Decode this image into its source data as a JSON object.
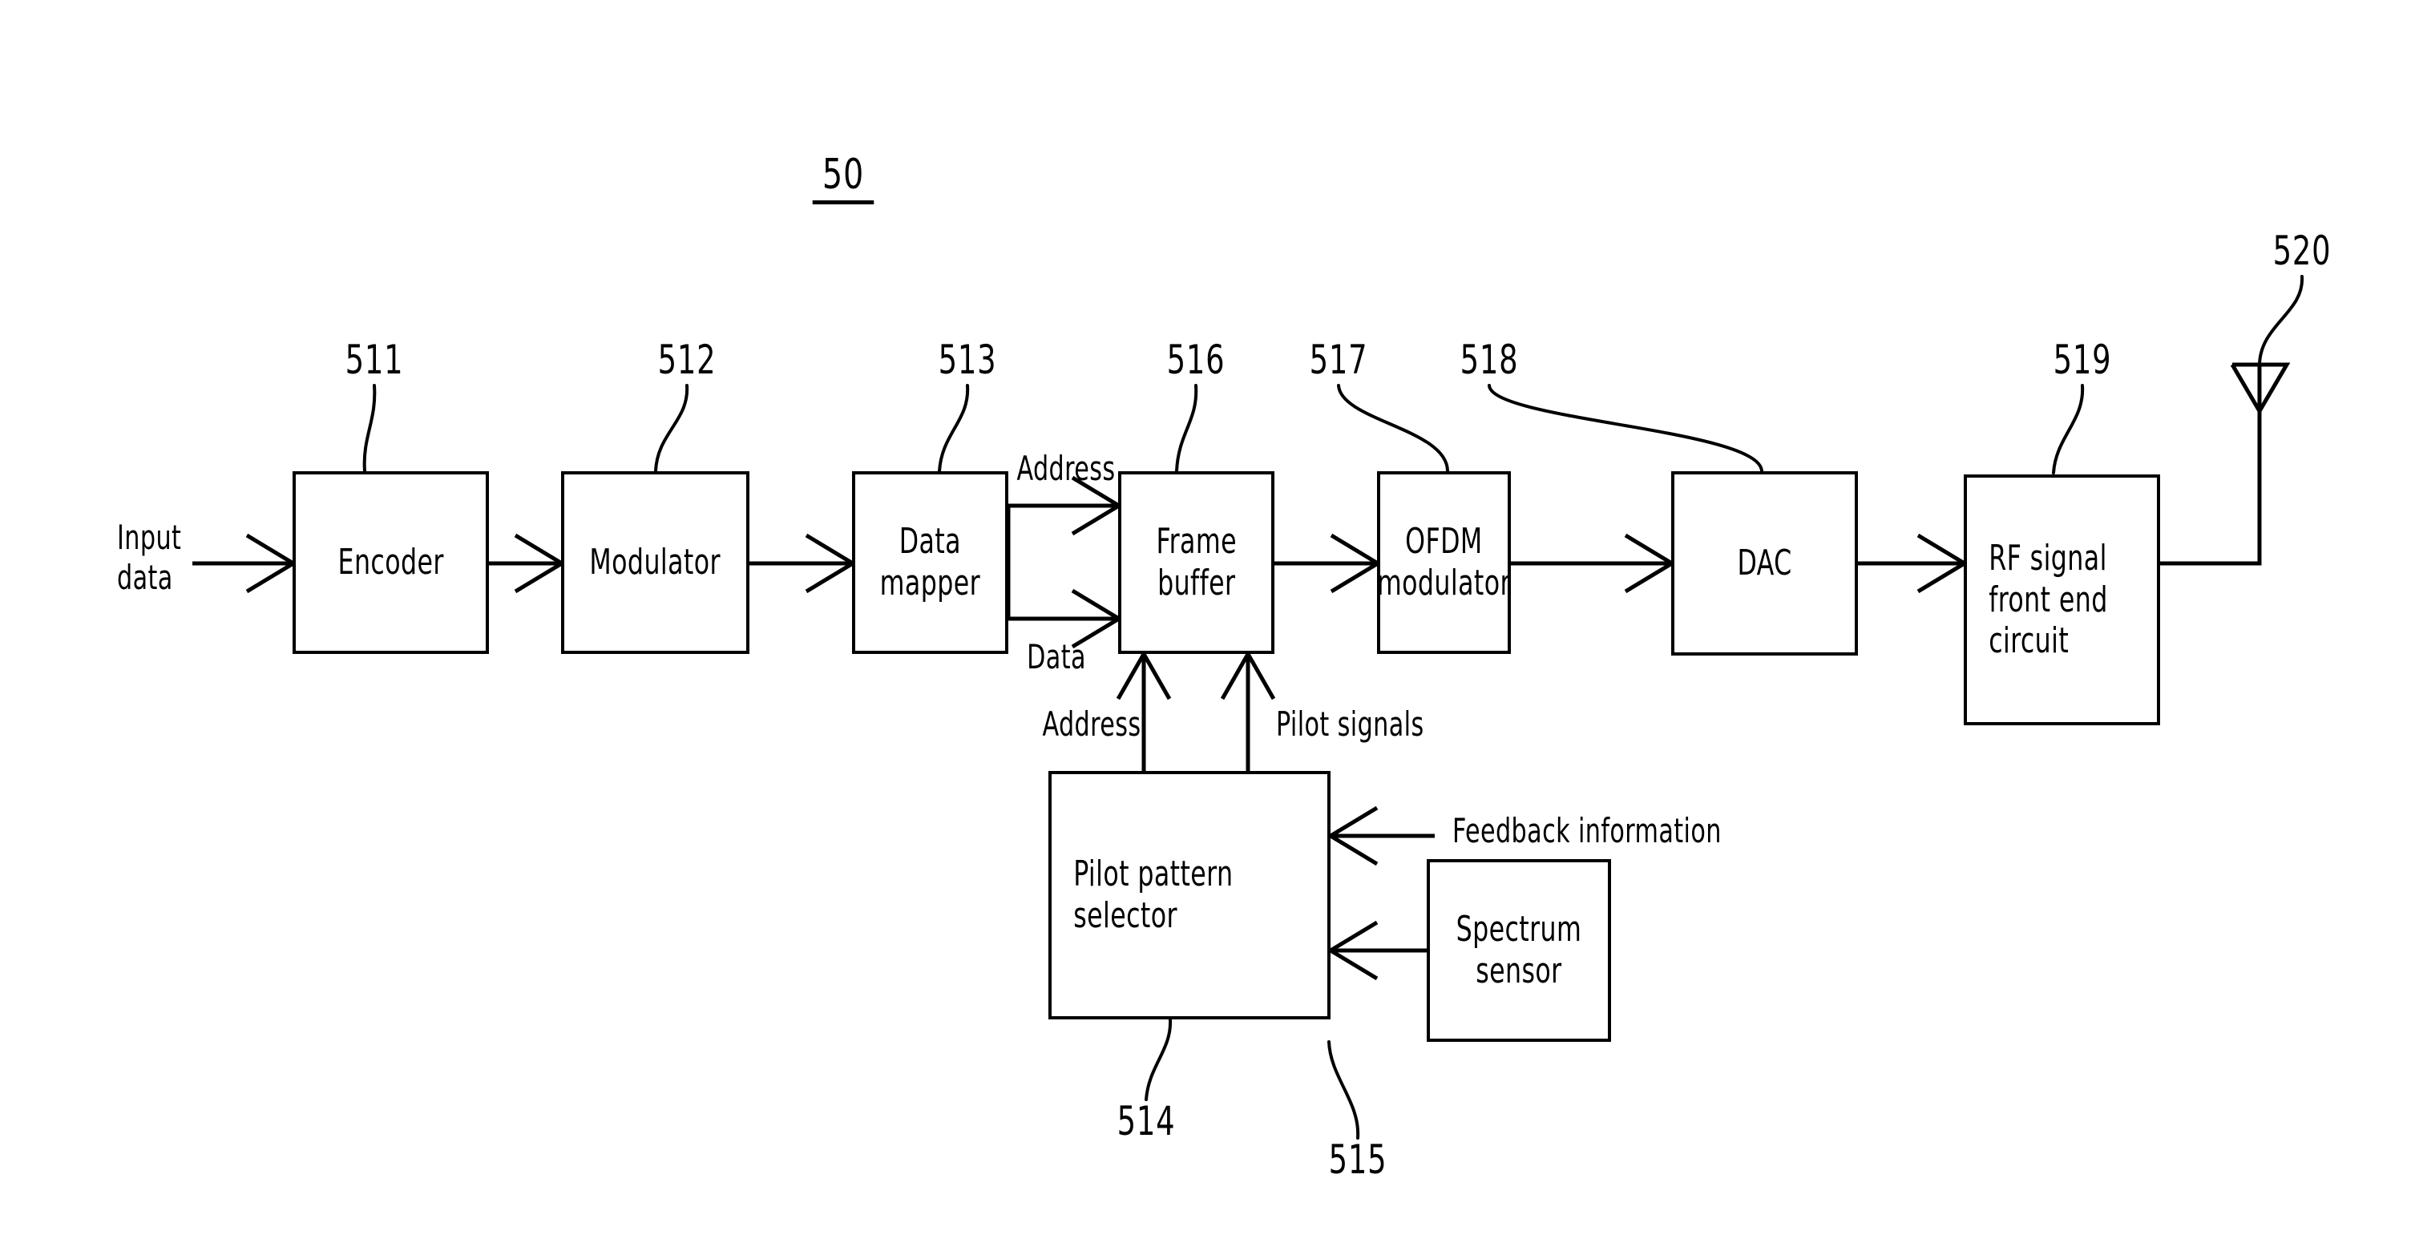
{
  "figure": {
    "number": "50",
    "kind": "transmitter block diagram"
  },
  "blocks": [
    {
      "id": "encoder",
      "label": "Encoder",
      "ref": "511"
    },
    {
      "id": "modulator",
      "label": "Modulator",
      "ref": "512"
    },
    {
      "id": "data_mapper",
      "label": "Data\nmapper",
      "ref": "513"
    },
    {
      "id": "frame_buffer",
      "label": "Frame\nbuffer",
      "ref": "516"
    },
    {
      "id": "ofdm_modulator",
      "label": "OFDM\nmodulator",
      "ref": "517"
    },
    {
      "id": "dac",
      "label": "DAC",
      "ref": "518"
    },
    {
      "id": "rf_front_end",
      "label": "RF  signal\nfront  end\ncircuit",
      "ref": "519"
    },
    {
      "id": "pilot_selector",
      "label": "Pilot  pattern\nselector",
      "ref": "514"
    },
    {
      "id": "spectrum_sensor",
      "label": "Spectrum\nsensor",
      "ref": "515"
    }
  ],
  "antenna": {
    "label_ref": "520",
    "name": "antenna"
  },
  "signals": {
    "input_data": "Input\ndata",
    "address_top": "Address",
    "data_bottom": "Data",
    "address_up": "Address",
    "pilot_signals": "Pilot  signals",
    "feedback_information": "Feedback  information"
  },
  "refs": {
    "r511": "511",
    "r512": "512",
    "r513": "513",
    "r514": "514",
    "r515": "515",
    "r516": "516",
    "r517": "517",
    "r518": "518",
    "r519": "519",
    "r520": "520"
  },
  "colors": {
    "ink": "#000000",
    "paper": "#ffffff"
  }
}
